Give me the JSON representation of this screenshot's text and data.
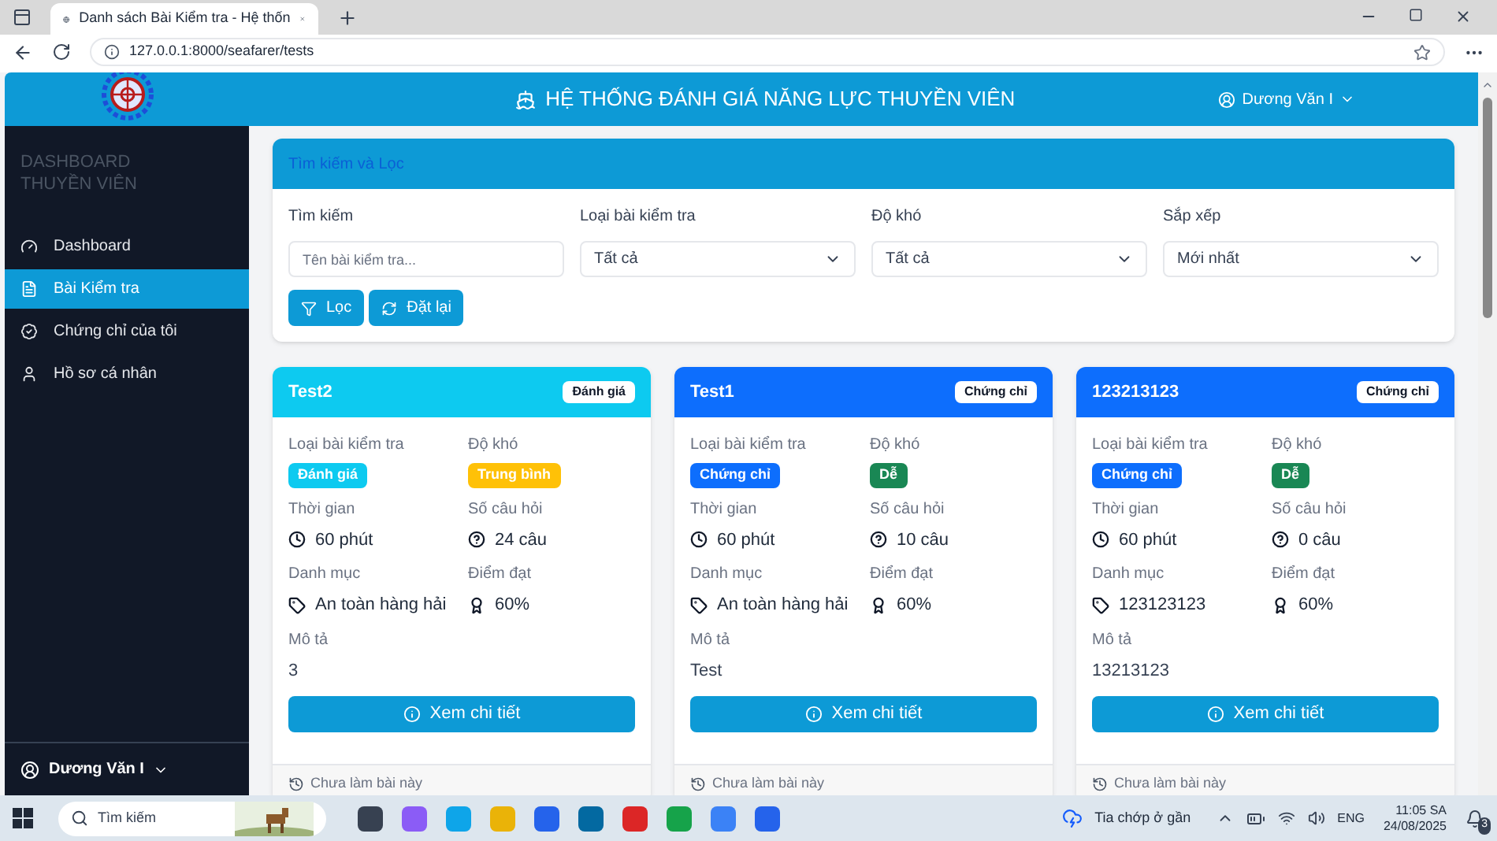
{
  "browser": {
    "tab_title": "Danh sách Bài Kiểm tra - Hệ thốn",
    "url": "127.0.0.1:8000/seafarer/tests"
  },
  "navbar": {
    "title": "HỆ THỐNG ĐÁNH GIÁ NĂNG LỰC THUYỀN VIÊN",
    "user": "Dương Văn I"
  },
  "sidebar": {
    "title": "DASHBOARD THUYỀN VIÊN",
    "items": [
      {
        "label": "Dashboard",
        "selected": false
      },
      {
        "label": "Bài Kiểm tra",
        "selected": true
      },
      {
        "label": "Chứng chỉ của tôi",
        "selected": false
      },
      {
        "label": "Hồ sơ cá nhân",
        "selected": false
      }
    ],
    "user": "Dương Văn I"
  },
  "filter": {
    "title": "Tìm kiếm và Lọc",
    "fields": [
      {
        "kind": "input",
        "label": "Tìm kiếm",
        "placeholder": "Tên bài kiểm tra..."
      },
      {
        "kind": "select",
        "label": "Loại bài kiểm tra",
        "value": "Tất cả"
      },
      {
        "kind": "select",
        "label": "Độ khó",
        "value": "Tất cả"
      },
      {
        "kind": "select",
        "label": "Sắp xếp",
        "value": "Mới nhất"
      }
    ],
    "buttons": [
      {
        "label": "Lọc"
      },
      {
        "label": "Đặt lại"
      }
    ]
  },
  "cards": [
    {
      "title": "Test2",
      "color": "#0dcaf0",
      "tag": "Đánh giá",
      "fields": [
        {
          "kind": "badge",
          "label": "Loại bài kiểm tra",
          "value": "Đánh giá",
          "color": "#0dcaf0"
        },
        {
          "kind": "badge",
          "label": "Độ khó",
          "value": "Trung bình",
          "color": "#ffc107"
        },
        {
          "kind": "duration",
          "label": "Thời gian",
          "value": "60 phút"
        },
        {
          "kind": "questions",
          "label": "Số câu hỏi",
          "value": "24 câu"
        },
        {
          "kind": "category",
          "label": "Danh mục",
          "value": "An toàn hàng hải"
        },
        {
          "kind": "score",
          "label": "Điểm đạt",
          "value": "60%"
        },
        {
          "kind": "text",
          "label": "Mô tả",
          "value": "3"
        }
      ],
      "button": "Xem chi tiết",
      "status": "Chưa làm bài này"
    },
    {
      "title": "Test1",
      "color": "#0d6efd",
      "tag": "Chứng chỉ",
      "fields": [
        {
          "kind": "badge",
          "label": "Loại bài kiểm tra",
          "value": "Chứng chỉ",
          "color": "#0d6efd"
        },
        {
          "kind": "badge",
          "label": "Độ khó",
          "value": "Dễ",
          "color": "#198754"
        },
        {
          "kind": "duration",
          "label": "Thời gian",
          "value": "60 phút"
        },
        {
          "kind": "questions",
          "label": "Số câu hỏi",
          "value": "10 câu"
        },
        {
          "kind": "category",
          "label": "Danh mục",
          "value": "An toàn hàng hải"
        },
        {
          "kind": "score",
          "label": "Điểm đạt",
          "value": "60%"
        },
        {
          "kind": "text",
          "label": "Mô tả",
          "value": "Test"
        }
      ],
      "button": "Xem chi tiết",
      "status": "Chưa làm bài này"
    },
    {
      "title": "123213123",
      "color": "#0d6efd",
      "tag": "Chứng chỉ",
      "fields": [
        {
          "kind": "badge",
          "label": "Loại bài kiểm tra",
          "value": "Chứng chỉ",
          "color": "#0d6efd"
        },
        {
          "kind": "badge",
          "label": "Độ khó",
          "value": "Dễ",
          "color": "#198754"
        },
        {
          "kind": "duration",
          "label": "Thời gian",
          "value": "60 phút"
        },
        {
          "kind": "questions",
          "label": "Số câu hỏi",
          "value": "0 câu"
        },
        {
          "kind": "category",
          "label": "Danh mục",
          "value": "123123123"
        },
        {
          "kind": "score",
          "label": "Điểm đạt",
          "value": "60%"
        },
        {
          "kind": "text",
          "label": "Mô tả",
          "value": "13213123"
        }
      ],
      "button": "Xem chi tiết",
      "status": "Chưa làm bài này"
    }
  ],
  "taskbar": {
    "search": "Tìm kiếm",
    "weather": "Tia chớp ở gần",
    "language": "ENG",
    "time": "11:05 SA",
    "date": "24/08/2025",
    "notifications": "3"
  }
}
